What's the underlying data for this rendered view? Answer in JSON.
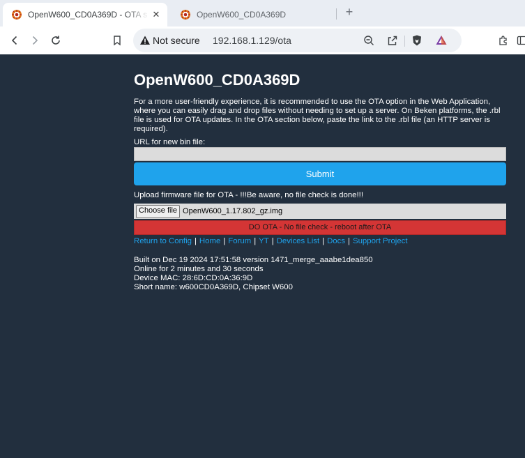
{
  "browser": {
    "tabs": [
      {
        "title": "OpenW600_CD0A369D - OTA s",
        "active": true
      },
      {
        "title": "OpenW600_CD0A369D",
        "active": false
      }
    ],
    "security_label": "Not secure",
    "url": "192.168.1.129/ota"
  },
  "page": {
    "title": "OpenW600_CD0A369D",
    "intro": "For a more user-friendly experience, it is recommended to use the OTA option in the Web Application, where you can easily drag and drop files without needing to set up a server. On Beken platforms, the .rbl file is used for OTA updates. In the OTA section below, paste the link to the .rbl file (an HTTP server is required).",
    "url_label": "URL for new bin file:",
    "url_value": "",
    "submit_label": "Submit",
    "upload_label": "Upload firmware file for OTA - !!!Be aware, no file check is done!!!",
    "choose_file_label": "Choose file",
    "file_name": "OpenW600_1.17.802_gz.img",
    "ota_button_label": "DO OTA - No file check - reboot after OTA",
    "links": {
      "config": "Return to Config",
      "home": "Home",
      "forum": "Forum",
      "yt": "YT",
      "devices": "Devices List",
      "docs": "Docs",
      "support": "Support Project"
    },
    "info": {
      "built": "Built on Dec 19 2024 17:51:58 version 1471_merge_aaabe1dea850",
      "online": "Online for 2 minutes and 30 seconds",
      "mac": "Device MAC: 28:6D:CD:0A:36:9D",
      "short_name": "Short name: w600CD0A369D, Chipset W600"
    }
  },
  "colors": {
    "page_bg": "#222f3e",
    "accent_blue": "#1fa3ec",
    "danger_red": "#d43535"
  }
}
